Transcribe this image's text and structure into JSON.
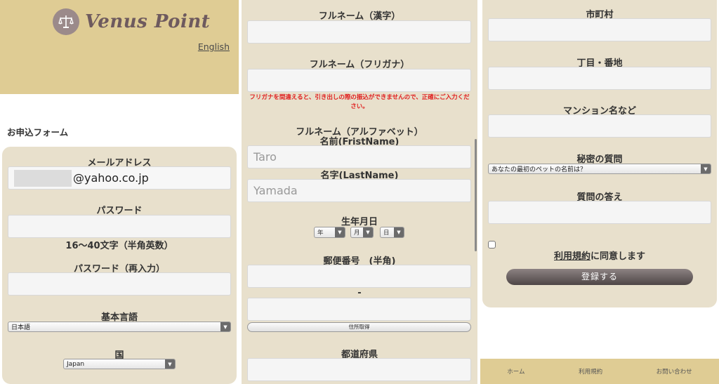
{
  "header": {
    "logo_text": "Venus Point",
    "language_link": "English"
  },
  "form": {
    "heading": "お申込フォーム",
    "email": {
      "label": "メールアドレス",
      "value": "@yahoo.co.jp"
    },
    "password": {
      "label": "パスワード",
      "hint": "16〜40文字（半角英数）"
    },
    "password_confirm": {
      "label": "パスワード（再入力）"
    },
    "base_language": {
      "label": "基本言語",
      "selected": "日本語"
    },
    "country": {
      "label": "国",
      "selected": "Japan"
    },
    "fullname_kanji": {
      "label": "フルネーム（漢字）"
    },
    "fullname_kana": {
      "label": "フルネーム（フリガナ）",
      "warning": "フリガナを間違えると、引き出しの際の振込ができませんので、正確にご入力ください。"
    },
    "fullname_alpha": {
      "label": "フルネーム（アルファベット）",
      "first_label": "名前(FristName)",
      "first_placeholder": "Taro",
      "last_label": "名字(LastName)",
      "last_placeholder": "Yamada"
    },
    "birthdate": {
      "label": "生年月日",
      "year": "年",
      "month": "月",
      "day": "日"
    },
    "postal": {
      "label": "郵便番号　(半角)",
      "separator": "-",
      "lookup_button": "住所取得"
    },
    "prefecture": {
      "label": "都道府県"
    },
    "city": {
      "label": "市町村"
    },
    "street": {
      "label": "丁目・番地"
    },
    "building": {
      "label": "マンション名など"
    },
    "secret_question": {
      "label": "秘密の質問",
      "selected": "あなたの最初のペットの名前は？"
    },
    "secret_answer": {
      "label": "質問の答え"
    },
    "terms": {
      "link_text": "利用規約",
      "suffix": "に同意します"
    },
    "submit_label": "登録する"
  },
  "footer": {
    "items": [
      "ホーム",
      "利用規約",
      "お問い合わせ"
    ]
  }
}
